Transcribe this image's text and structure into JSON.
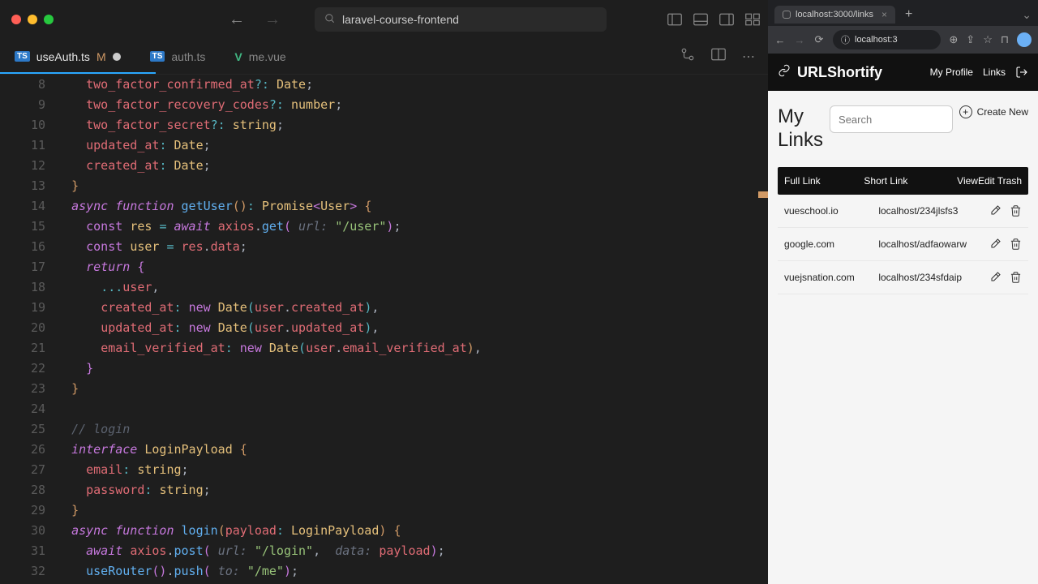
{
  "editor": {
    "project": "laravel-course-frontend",
    "tabs": [
      {
        "file": "useAuth.ts",
        "badge": "TS",
        "modified": "M",
        "active": true,
        "dirty": true
      },
      {
        "file": "auth.ts",
        "badge": "TS",
        "modified": "",
        "active": false,
        "dirty": false
      },
      {
        "file": "me.vue",
        "badge": "V",
        "modified": "",
        "active": false,
        "dirty": false
      }
    ],
    "lines_start": 8,
    "lines": [
      {
        "n": 8,
        "html": "    <span class='prop'>two_factor_confirmed_at</span><span class='op'>?:</span> <span class='cls'>Date</span>;"
      },
      {
        "n": 9,
        "html": "    <span class='prop'>two_factor_recovery_codes</span><span class='op'>?:</span> <span class='cls'>number</span>;"
      },
      {
        "n": 10,
        "html": "    <span class='prop'>two_factor_secret</span><span class='op'>?:</span> <span class='cls'>string</span>;"
      },
      {
        "n": 11,
        "html": "    <span class='prop'>updated_at</span><span class='op'>:</span> <span class='cls'>Date</span>;"
      },
      {
        "n": 12,
        "html": "    <span class='prop'>created_at</span><span class='op'>:</span> <span class='cls'>Date</span>;"
      },
      {
        "n": 13,
        "html": "  <span class='brace'>}</span>"
      },
      {
        "n": 14,
        "html": "  <span class='kw'>async</span> <span class='kw'>function</span> <span class='fn'>getUser</span><span class='brace'>()</span><span class='op'>:</span> <span class='cls'>Promise</span><span class='bracket1'>&lt;</span><span class='cls'>User</span><span class='bracket1'>&gt;</span> <span class='brace'>{</span>"
      },
      {
        "n": 15,
        "html": "    <span class='kw2'>const</span> <span class='const'>res</span> <span class='op'>=</span> <span class='ctrl'>await</span> <span class='var'>axios</span>.<span class='fn'>get</span><span class='bracket1'>(</span> <span class='paramhint'>url:</span> <span class='str'>\"/user\"</span><span class='bracket1'>)</span>;"
      },
      {
        "n": 16,
        "html": "    <span class='kw2'>const</span> <span class='const'>user</span> <span class='op'>=</span> <span class='var'>res</span>.<span class='var'>data</span>;"
      },
      {
        "n": 17,
        "html": "    <span class='ctrl'>return</span> <span class='bracket1'>{</span>"
      },
      {
        "n": 18,
        "html": "      <span class='op'>...</span><span class='var'>user</span>,"
      },
      {
        "n": 19,
        "html": "      <span class='prop'>created_at</span><span class='op'>:</span> <span class='new'>new</span> <span class='cls'>Date</span><span class='bracket2'>(</span><span class='var'>user</span>.<span class='var'>created_at</span><span class='bracket2'>)</span>,"
      },
      {
        "n": 20,
        "html": "      <span class='prop'>updated_at</span><span class='op'>:</span> <span class='new'>new</span> <span class='cls'>Date</span><span class='bracket2'>(</span><span class='var'>user</span>.<span class='var'>updated_at</span><span class='bracket2'>)</span>,"
      },
      {
        "n": 21,
        "html": "      <span class='prop'>email_verified_at</span><span class='op'>:</span> <span class='new'>new</span> <span class='cls'>Date</span><span class='bracket2'>(</span><span class='var'>user</span>.<span class='var'>email_verified_at</span><span class='brace'>)</span>,"
      },
      {
        "n": 22,
        "html": "    <span class='bracket1'>}</span>"
      },
      {
        "n": 23,
        "html": "  <span class='brace'>}</span>"
      },
      {
        "n": 24,
        "html": " "
      },
      {
        "n": 25,
        "html": "  <span class='cmt'>// login</span>"
      },
      {
        "n": 26,
        "html": "  <span class='kw'>interface</span> <span class='cls'>LoginPayload</span> <span class='brace'>{</span>"
      },
      {
        "n": 27,
        "html": "    <span class='prop'>email</span><span class='op'>:</span> <span class='cls'>string</span>;"
      },
      {
        "n": 28,
        "html": "    <span class='prop'>password</span><span class='op'>:</span> <span class='cls'>string</span>;"
      },
      {
        "n": 29,
        "html": "  <span class='brace'>}</span>"
      },
      {
        "n": 30,
        "html": "  <span class='kw'>async</span> <span class='kw'>function</span> <span class='fn'>login</span><span class='brace'>(</span><span class='var'>payload</span><span class='op'>:</span> <span class='cls'>LoginPayload</span><span class='brace'>)</span> <span class='brace'>{</span>"
      },
      {
        "n": 31,
        "html": "    <span class='ctrl'>await</span> <span class='var'>axios</span>.<span class='fn'>post</span><span class='bracket1'>(</span> <span class='paramhint'>url:</span> <span class='str'>\"/login\"</span>,  <span class='paramhint'>data:</span> <span class='var'>payload</span><span class='bracket1'>)</span>;"
      },
      {
        "n": 32,
        "html": "    <span class='fn'>useRouter</span><span class='bracket1'>()</span>.<span class='fn'>push</span><span class='bracket1'>(</span> <span class='paramhint'>to:</span> <span class='str'>\"/me\"</span><span class='bracket1'>)</span>;"
      }
    ]
  },
  "browser": {
    "tab_title": "localhost:3000/links",
    "url": "localhost:3",
    "app": {
      "brand": "URLShortify",
      "nav": {
        "profile": "My Profile",
        "links": "Links"
      },
      "title_line1": "My",
      "title_line2": "Links",
      "search_placeholder": "Search",
      "create_label": "Create New",
      "table_headers": {
        "full": "Full Link",
        "short": "Short Link",
        "actions": "ViewEdit Trash"
      },
      "rows": [
        {
          "full": "vueschool.io",
          "short": "localhost/234jlsfs3"
        },
        {
          "full": "google.com",
          "short": "localhost/adfaowarw"
        },
        {
          "full": "vuejsnation.com",
          "short": "localhost/234sfdaip"
        }
      ]
    }
  }
}
